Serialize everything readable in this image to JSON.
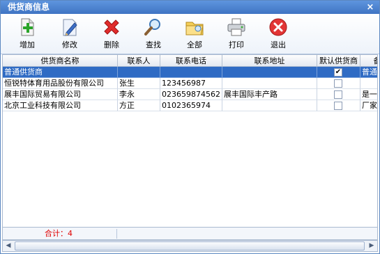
{
  "window": {
    "title": "供货商信息",
    "close_glyph": "×"
  },
  "toolbar": [
    {
      "name": "add",
      "label": "增加",
      "icon": "add-icon"
    },
    {
      "name": "edit",
      "label": "修改",
      "icon": "edit-icon"
    },
    {
      "name": "delete",
      "label": "删除",
      "icon": "delete-icon"
    },
    {
      "name": "search",
      "label": "查找",
      "icon": "search-icon"
    },
    {
      "name": "all",
      "label": "全部",
      "icon": "folder-icon"
    },
    {
      "name": "print",
      "label": "打印",
      "icon": "printer-icon"
    },
    {
      "name": "exit",
      "label": "退出",
      "icon": "exit-icon"
    }
  ],
  "table": {
    "columns": [
      "供货商名称",
      "联系人",
      "联系电话",
      "联系地址",
      "默认供货商",
      "备注"
    ],
    "rows": [
      {
        "name": "普通供货商",
        "contact": "",
        "phone": "",
        "address": "",
        "default": true,
        "note": "普通供货商"
      },
      {
        "name": "恒锐特体育用品股份有限公司",
        "contact": "张生",
        "phone": "123456987",
        "address": "",
        "default": false,
        "note": ""
      },
      {
        "name": "展丰国际贸易有限公司",
        "contact": "李永",
        "phone": "023659874562",
        "address": "展丰国际丰产路",
        "default": false,
        "note": "是一家"
      },
      {
        "name": "北京工业科技有限公司",
        "contact": "方正",
        "phone": "0102365974",
        "address": "",
        "default": false,
        "note": "厂家直"
      }
    ],
    "check_glyph": "✔"
  },
  "footer": {
    "total": "合计：4"
  },
  "scrollbar": {
    "left": "◀",
    "right": "▶"
  }
}
